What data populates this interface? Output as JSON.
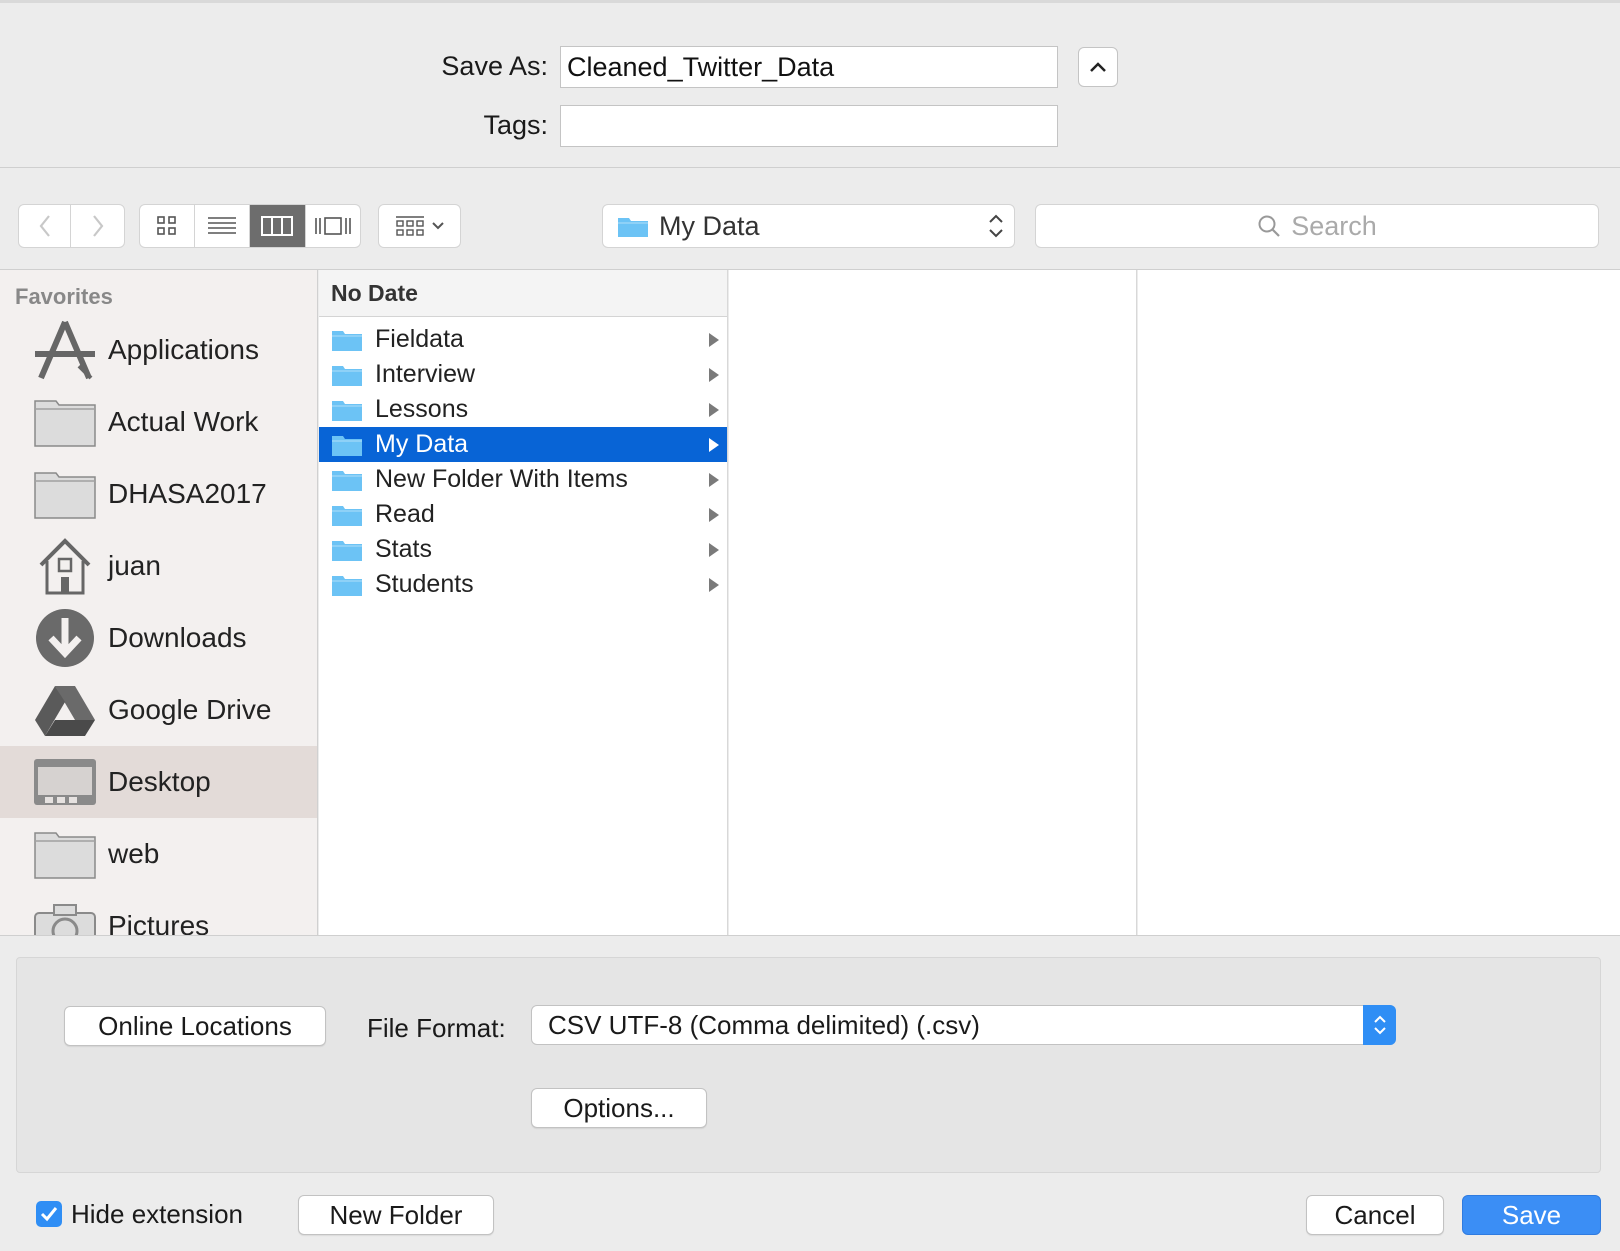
{
  "header": {
    "save_as_label": "Save As:",
    "save_as_value": "Cleaned_Twitter_Data",
    "tags_label": "Tags:",
    "tags_value": ""
  },
  "toolbar": {
    "path_label": "My Data",
    "search_placeholder": "Search"
  },
  "sidebar": {
    "heading": "Favorites",
    "items": [
      {
        "label": "Applications",
        "icon": "applications-icon"
      },
      {
        "label": "Actual Work",
        "icon": "folder-icon"
      },
      {
        "label": "DHASA2017",
        "icon": "folder-icon"
      },
      {
        "label": "juan",
        "icon": "home-icon"
      },
      {
        "label": "Downloads",
        "icon": "downloads-icon"
      },
      {
        "label": "Google Drive",
        "icon": "google-drive-icon"
      },
      {
        "label": "Desktop",
        "icon": "desktop-icon",
        "selected": true
      },
      {
        "label": "web",
        "icon": "folder-icon"
      },
      {
        "label": "Pictures",
        "icon": "camera-icon"
      }
    ]
  },
  "browser": {
    "column_header": "No Date",
    "folders": [
      {
        "name": "Fieldata"
      },
      {
        "name": "Interview"
      },
      {
        "name": "Lessons"
      },
      {
        "name": "My Data",
        "selected": true
      },
      {
        "name": "New Folder With Items"
      },
      {
        "name": "Read"
      },
      {
        "name": "Stats"
      },
      {
        "name": "Students"
      }
    ]
  },
  "accessory": {
    "online_locations_label": "Online Locations",
    "file_format_label": "File Format:",
    "file_format_value": "CSV UTF-8 (Comma delimited) (.csv)",
    "options_label": "Options..."
  },
  "footer": {
    "hide_extension_label": "Hide extension",
    "hide_extension_checked": true,
    "new_folder_label": "New Folder",
    "cancel_label": "Cancel",
    "save_label": "Save"
  },
  "colors": {
    "selection_blue": "#0864d6",
    "accent_blue": "#3b8ef5",
    "folder_blue": "#6cc3f5"
  }
}
